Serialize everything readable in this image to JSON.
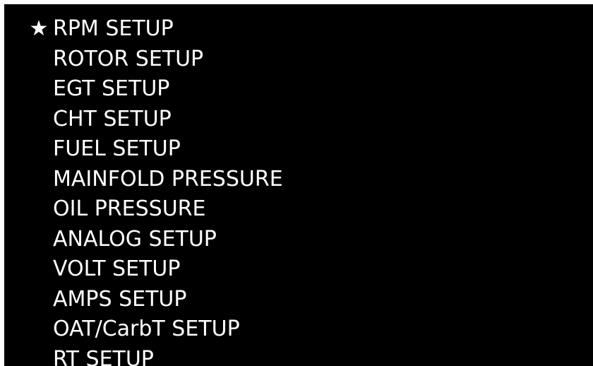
{
  "menu": {
    "selection_marker": "★",
    "items": [
      {
        "label": "RPM SETUP",
        "selected": true
      },
      {
        "label": "ROTOR SETUP",
        "selected": false
      },
      {
        "label": "EGT SETUP",
        "selected": false
      },
      {
        "label": "CHT SETUP",
        "selected": false
      },
      {
        "label": "FUEL SETUP",
        "selected": false
      },
      {
        "label": "MAINFOLD PRESSURE",
        "selected": false
      },
      {
        "label": "OIL PRESSURE",
        "selected": false
      },
      {
        "label": "ANALOG SETUP",
        "selected": false
      },
      {
        "label": "VOLT SETUP",
        "selected": false
      },
      {
        "label": "AMPS SETUP",
        "selected": false
      },
      {
        "label": "OAT/CarbT SETUP",
        "selected": false
      },
      {
        "label": "RT SETUP",
        "selected": false
      }
    ]
  },
  "colors": {
    "background": "#000000",
    "text": "#ffffff"
  }
}
